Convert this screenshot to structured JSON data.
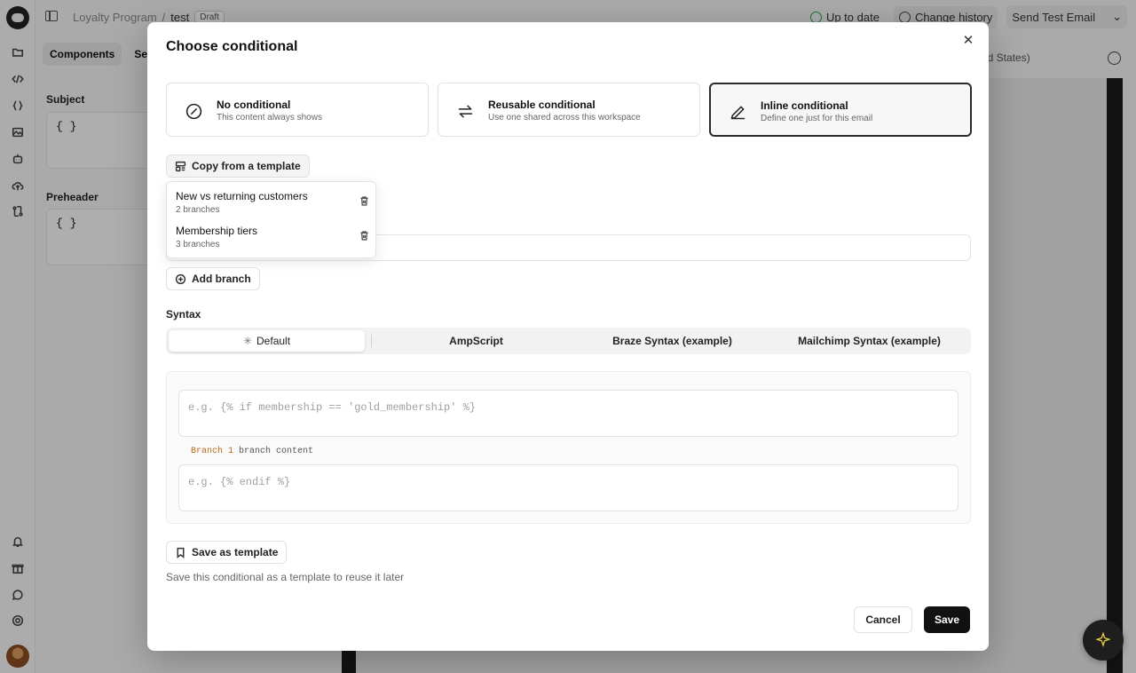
{
  "topbar": {
    "project": "Loyalty Program",
    "separator": "/",
    "email_name": "test",
    "status_badge": "Draft",
    "sync_status": "Up to date",
    "history_label": "Change history",
    "send_test_label": "Send Test Email"
  },
  "left_panel": {
    "tabs": [
      "Components",
      "Setti"
    ],
    "subject_label": "Subject",
    "subject_value": "{ }",
    "preheader_label": "Preheader",
    "preheader_value": "{ }"
  },
  "locale_partial": "ited States)",
  "modal": {
    "title": "Choose conditional",
    "options": [
      {
        "title": "No conditional",
        "subtitle": "This content always shows",
        "icon": "slash-circle-icon",
        "selected": false
      },
      {
        "title": "Reusable conditional",
        "subtitle": "Use one shared across this workspace",
        "icon": "arrows-repeat-icon",
        "selected": false
      },
      {
        "title": "Inline conditional",
        "subtitle": "Define one just for this email",
        "icon": "pencil-icon",
        "selected": true
      }
    ],
    "copy_template_label": "Copy from a template",
    "templates": [
      {
        "name": "New vs returning customers",
        "count": "2 branches"
      },
      {
        "name": "Membership tiers",
        "count": "3 branches"
      }
    ],
    "add_branch_label": "Add branch",
    "syntax_label": "Syntax",
    "syntax_tabs": [
      "Default",
      "AmpScript",
      "Braze Syntax (example)",
      "Mailchimp Syntax (example)"
    ],
    "syntax_active": "Default",
    "open_placeholder": "e.g. {% if membership == 'gold_membership' %}",
    "branch_keyword": "Branch 1",
    "branch_rest": "branch content",
    "close_placeholder": "e.g. {% endif %}",
    "save_template_label": "Save as template",
    "save_template_hint": "Save this conditional as a template to reuse it later",
    "cancel_label": "Cancel",
    "save_label": "Save"
  },
  "colors": {
    "selected_border": "#2b2b2b",
    "primary_button": "#111111",
    "sync_ok": "#2a9d4a",
    "branch_keyword": "#b86a1a"
  }
}
